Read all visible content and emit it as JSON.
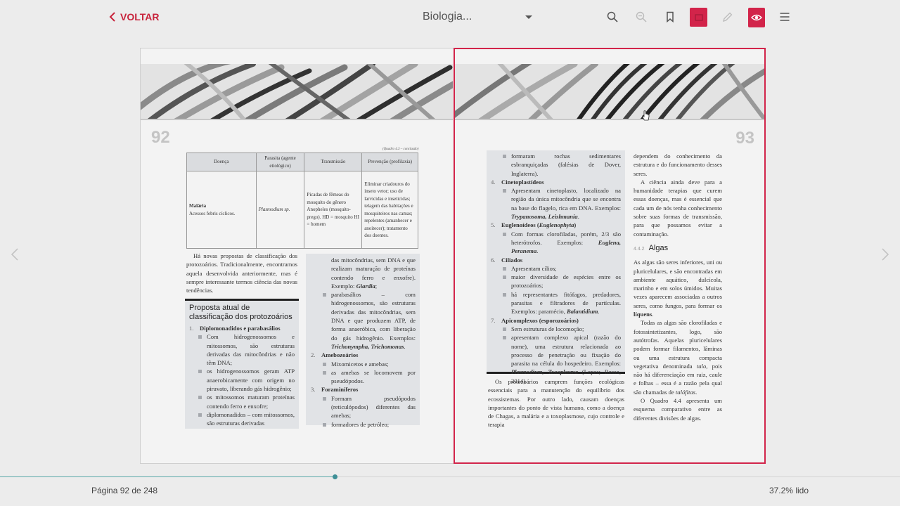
{
  "topbar": {
    "back_label": "VOLTAR",
    "book_title": "Biologia...",
    "icons": [
      "search-icon",
      "zoom-out-icon",
      "bookmark-icon",
      "highlight-icon",
      "pencil-icon",
      "eye-icon",
      "menu-icon"
    ],
    "accent_color": "#d2244a"
  },
  "left_page": {
    "number": "92",
    "table_caption": "(Quadro 4.3 – conclusão)",
    "table": {
      "headers": [
        "Doença",
        "Parasita (agente etiológico)",
        "Transmissão",
        "Prevenção (profilaxia)"
      ],
      "row": {
        "disease": "Malária",
        "disease_note": "Acessos febris cíclicos.",
        "parasite": "Plasmodium sp.",
        "transmission": "Picadas de fêmeas do mosquito do gênero Anopheles (mosquito-prego). HD = mosquito HI = homem",
        "prevention": "Eliminar criadouros do inseto vetor; uso de larvicidas e inseticidas; telagem das habitações e mosquiteiros nas camas; repelentes (amanhecer e anoitecer); tratamento dos doentes."
      }
    },
    "intro_paragraph": "Há novas propostas de classificação dos protozoários. Tradicionalmente, encontramos aquela desenvolvida anteriormente, mas é sempre interessante termos ciência das novas tendências.",
    "box_title": "Proposta atual de classificação dos protozoários",
    "box_left": {
      "item1_num": "1.",
      "item1_head": "Diplomonadidos e parabasálios",
      "item1_bullets": [
        "Com hidrogenossomos e mitossomos, são estruturas derivadas das mitocôndrias e não têm DNA;",
        "os hidrogenossomos geram ATP anaerobicamente com origem no piruvato, liberando gás hidrogênio;",
        "os mitossomos maturam proteínas contendo ferro e enxofre;",
        "diplomonadidos – com mitossomos, são estruturas derivadas"
      ]
    },
    "box_right": {
      "cont_lines": "das mitocôndrias, sem DNA e que realizam maturação de proteínas contendo ferro e enxofre). Exemplo:",
      "cont_example": "Giardia",
      "bullet2_text": "parabasálios – com hidrogenossomos, são estruturas derivadas das mitocôndrias, sem DNA e que produzem ATP, de forma anaeróbica, com liberação do gás hidrogênio. Exemplos:",
      "bullet2_examples": "Trichonympha, Trichomonas",
      "item2_num": "2.",
      "item2_head": "Amebozoários",
      "item2_bullets": [
        "Mixomicetos e amebas;",
        "as amebas se locomovem por pseudópodos."
      ],
      "item3_num": "3.",
      "item3_head": "Foraminíferos",
      "item3_bullets": [
        "Formam pseudópodos (reticulópodos) diferentes das amebas;",
        "formadores de petróleo;"
      ]
    }
  },
  "right_page": {
    "number": "93",
    "box": {
      "cont_bullet": "formaram rochas sedimentares esbranquiçadas (falésias de Dover, Inglaterra).",
      "item4_num": "4.",
      "item4_head": "Cinetoplastídeos",
      "item4_text": "Apresentam cinetoplasto, localizado na região da única mitocôndria que se encontra na base do flagelo, rica em DNA. Exemplos:",
      "item4_examples": "Trypanosoma, Leishmania",
      "item5_num": "5.",
      "item5_head": "Euglenoídeos (",
      "item5_head_it": "Euglenophyta",
      "item5_text": "Com formas clorofiladas, porém, 2/3 são heterótrofos. Exemplos:",
      "item5_examples": "Euglena, Peranema",
      "item6_num": "6.",
      "item6_head": "Ciliados",
      "item6_bullets": [
        "Apresentam cílios;",
        "maior diversidade de espécies entre os protozoários;"
      ],
      "item6_b3": "há representantes fitófagos, predadores, parasitas e filtradores de partículas. Exemplos: paramécio,",
      "item6_b3_example": "Balantidium",
      "item7_num": "7.",
      "item7_head": "Apicomplexos (esporozoários)",
      "item7_b1": "Sem estruturas de locomoção;",
      "item7_b2": "apresentam complexo apical (razão do nome), uma estrutura relacionada ao processo de penetração ou fixação do parasita na célula do hospedeiro. Exemplos:",
      "item7_examples": "Plasmodium, Toxoplasma",
      "item7_ref": "(Lopes; Rosso, 2014)."
    },
    "col1_paragraph": "Os protozoários cumprem funções ecológicas essenciais para a manutenção do equilíbrio dos ecossistemas. Por outro lado, causam doenças importantes do ponto de vista humano, como a doença de Chagas, a malária e a toxoplasmose, cujo controle e terapia",
    "col2_p1": "dependem do conhecimento da estrutura e do funcionamento desses seres.",
    "col2_p2": "A ciência ainda deve para a humanidade terapias que curem essas doenças, mas é essencial que cada um de nós tenha conhecimento sobre suas formas de transmissão, para que possamos evitar a contaminação.",
    "section_num": "4.4.2",
    "section_title": "Algas",
    "col2_p3a": "As algas são seres inferiores, uni ou pluricelulares, e são encontradas em ambiente aquático, dulcícola, marinho e em solos úmidos. Muitas vezes aparecem associadas a outros seres, como fungos, para formar os",
    "col2_p3b": "líquens",
    "col2_p4a": "Todas as algas são clorofiladas e fotossintetizantes, logo, são autótrofas. Aquelas pluricelulares podem formar filamentos, lâminas ou uma estrutura compacta vegetativa denominada",
    "col2_p4_talo": "talo",
    "col2_p4b": ", pois não há diferenciação em raiz, caule e folhas – essa é a razão pela qual são chamadas de",
    "col2_p4_talofitas": "talófitas",
    "col2_p5": "O Quadro 4.4 apresenta um esquema comparativo entre as diferentes divisões de algas."
  },
  "footer": {
    "page_indicator": "Página 92 de 248",
    "read_percent": "37.2% lido",
    "progress_fraction": 0.372
  }
}
